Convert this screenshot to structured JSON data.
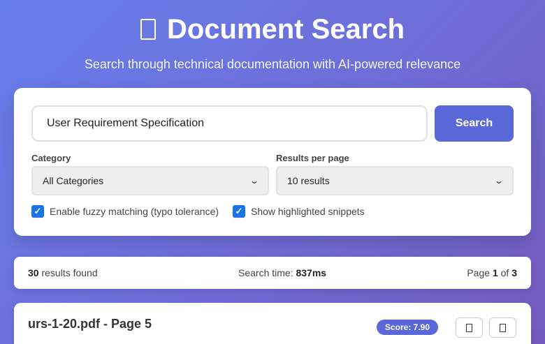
{
  "header": {
    "title": "Document Search",
    "subtitle": "Search through technical documentation with AI-powered relevance",
    "icon": "document-icon"
  },
  "search": {
    "query": "User Requirement Specification",
    "button_label": "Search",
    "category_label": "Category",
    "category_selected": "All Categories",
    "results_per_page_label": "Results per page",
    "results_per_page_selected": "10 results",
    "fuzzy_label": "Enable fuzzy matching (typo tolerance)",
    "fuzzy_checked": true,
    "snippets_label": "Show highlighted snippets",
    "snippets_checked": true
  },
  "stats": {
    "results_count": "30",
    "results_suffix": " results found",
    "search_time_label": "Search time: ",
    "search_time_value": "837ms",
    "page_label": "Page ",
    "page_current": "1",
    "page_of": " of ",
    "page_total": "3"
  },
  "results": [
    {
      "title": "urs-1-20.pdf - Page 5",
      "score": "Score: 7.90"
    }
  ],
  "colors": {
    "accent": "#5a67d8",
    "checkbox": "#1a73e8"
  }
}
